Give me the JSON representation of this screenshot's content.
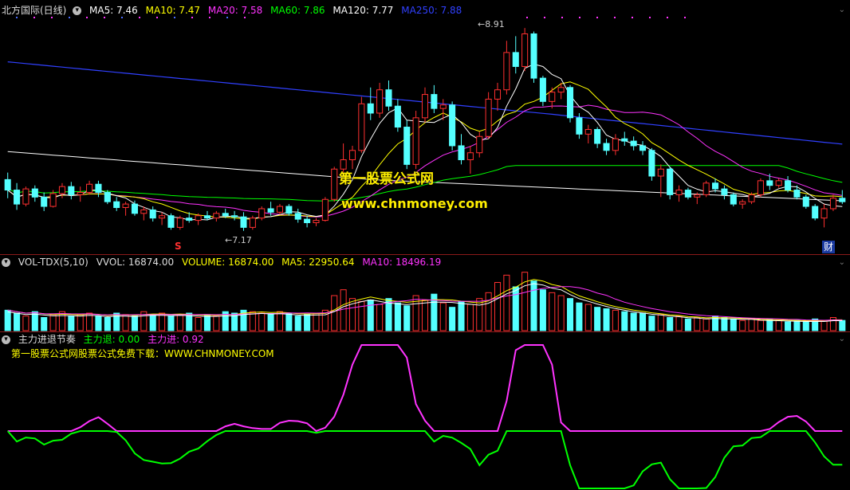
{
  "colors": {
    "up": "#ff3030",
    "down": "#54ffff",
    "ma5": "#ffffff",
    "ma10": "#ffff00",
    "ma20": "#ff33ff",
    "ma60": "#00ff00",
    "ma120": "#ffffff",
    "ma250": "#3040ff",
    "grid": "#8b1a1a"
  },
  "main": {
    "icon": "collapse-circle-icon",
    "title": "北方国际(日线)",
    "ma5": "MA5: 7.46",
    "ma10": "MA10: 7.47",
    "ma20": "MA20: 7.58",
    "ma60": "MA60: 7.86",
    "ma120": "MA120: 7.77",
    "ma250": "MA250: 7.88",
    "high_label": "8.91",
    "low_label": "7.17",
    "marker_s": "S",
    "marker_cai": "财",
    "watermark_title": "第一股票公式网",
    "watermark_url": "www.chnmoney.com"
  },
  "vol": {
    "title": "VOL-TDX(5,10)",
    "vvol": "VVOL: 16874.00",
    "volume": "VOLUME: 16874.00",
    "ma5": "MA5: 22950.64",
    "ma10": "MA10: 18496.19"
  },
  "ind": {
    "title": "主力进退节奏",
    "retreat": "主力退: 0.00",
    "advance": "主力进: 0.92",
    "note": "第一股票公式网股票公式免费下载：WWW.CHNMONEY.COM"
  },
  "chart_data": {
    "type": "candlestick",
    "price_range": [
      7.1,
      9.0
    ],
    "high": 8.91,
    "low": 7.17,
    "candles": [
      [
        7.61,
        7.67,
        7.45,
        7.52
      ],
      [
        7.52,
        7.58,
        7.35,
        7.4
      ],
      [
        7.4,
        7.55,
        7.38,
        7.53
      ],
      [
        7.53,
        7.56,
        7.42,
        7.46
      ],
      [
        7.46,
        7.5,
        7.34,
        7.38
      ],
      [
        7.38,
        7.52,
        7.37,
        7.49
      ],
      [
        7.49,
        7.58,
        7.45,
        7.55
      ],
      [
        7.55,
        7.59,
        7.44,
        7.48
      ],
      [
        7.48,
        7.55,
        7.42,
        7.5
      ],
      [
        7.5,
        7.6,
        7.48,
        7.57
      ],
      [
        7.57,
        7.6,
        7.46,
        7.5
      ],
      [
        7.5,
        7.52,
        7.4,
        7.42
      ],
      [
        7.42,
        7.46,
        7.34,
        7.37
      ],
      [
        7.37,
        7.42,
        7.3,
        7.4
      ],
      [
        7.4,
        7.43,
        7.3,
        7.32
      ],
      [
        7.32,
        7.38,
        7.26,
        7.35
      ],
      [
        7.35,
        7.38,
        7.25,
        7.28
      ],
      [
        7.28,
        7.33,
        7.22,
        7.3
      ],
      [
        7.3,
        7.32,
        7.18,
        7.2
      ],
      [
        7.2,
        7.3,
        7.18,
        7.28
      ],
      [
        7.28,
        7.33,
        7.24,
        7.26
      ],
      [
        7.26,
        7.32,
        7.22,
        7.3
      ],
      [
        7.3,
        7.34,
        7.26,
        7.28
      ],
      [
        7.28,
        7.34,
        7.25,
        7.32
      ],
      [
        7.32,
        7.36,
        7.28,
        7.3
      ],
      [
        7.3,
        7.34,
        7.26,
        7.29
      ],
      [
        7.29,
        7.33,
        7.17,
        7.2
      ],
      [
        7.2,
        7.3,
        7.18,
        7.28
      ],
      [
        7.28,
        7.38,
        7.26,
        7.36
      ],
      [
        7.36,
        7.42,
        7.3,
        7.33
      ],
      [
        7.33,
        7.4,
        7.31,
        7.38
      ],
      [
        7.38,
        7.4,
        7.3,
        7.32
      ],
      [
        7.32,
        7.36,
        7.24,
        7.27
      ],
      [
        7.27,
        7.3,
        7.2,
        7.24
      ],
      [
        7.24,
        7.28,
        7.21,
        7.26
      ],
      [
        7.26,
        7.46,
        7.25,
        7.44
      ],
      [
        7.44,
        7.72,
        7.42,
        7.7
      ],
      [
        7.7,
        7.92,
        7.66,
        7.78
      ],
      [
        7.78,
        7.9,
        7.7,
        7.86
      ],
      [
        7.86,
        8.32,
        7.84,
        8.26
      ],
      [
        8.26,
        8.4,
        8.12,
        8.18
      ],
      [
        8.18,
        8.44,
        8.14,
        8.38
      ],
      [
        8.38,
        8.46,
        8.2,
        8.24
      ],
      [
        8.24,
        8.3,
        8.02,
        8.06
      ],
      [
        8.06,
        8.12,
        7.7,
        7.74
      ],
      [
        7.74,
        8.2,
        7.7,
        8.14
      ],
      [
        8.14,
        8.4,
        8.1,
        8.34
      ],
      [
        8.34,
        8.42,
        8.18,
        8.22
      ],
      [
        8.22,
        8.3,
        8.12,
        8.25
      ],
      [
        8.25,
        8.28,
        7.86,
        7.9
      ],
      [
        7.9,
        8.0,
        7.74,
        7.78
      ],
      [
        7.78,
        7.9,
        7.66,
        7.84
      ],
      [
        7.84,
        8.02,
        7.8,
        7.98
      ],
      [
        7.98,
        8.36,
        7.96,
        8.3
      ],
      [
        8.3,
        8.44,
        8.2,
        8.38
      ],
      [
        8.38,
        8.8,
        8.34,
        8.7
      ],
      [
        8.7,
        8.84,
        8.52,
        8.58
      ],
      [
        8.58,
        8.91,
        8.54,
        8.86
      ],
      [
        8.86,
        8.88,
        8.44,
        8.48
      ],
      [
        8.48,
        8.5,
        8.24,
        8.28
      ],
      [
        8.28,
        8.4,
        8.22,
        8.36
      ],
      [
        8.36,
        8.44,
        8.3,
        8.4
      ],
      [
        8.4,
        8.42,
        8.1,
        8.14
      ],
      [
        8.14,
        8.18,
        7.96,
        8.0
      ],
      [
        8.0,
        8.08,
        7.92,
        8.04
      ],
      [
        8.04,
        8.06,
        7.88,
        7.92
      ],
      [
        7.92,
        7.96,
        7.82,
        7.86
      ],
      [
        7.86,
        8.0,
        7.82,
        7.96
      ],
      [
        7.96,
        8.02,
        7.9,
        7.94
      ],
      [
        7.94,
        7.98,
        7.86,
        7.9
      ],
      [
        7.9,
        7.94,
        7.82,
        7.86
      ],
      [
        7.86,
        7.88,
        7.6,
        7.64
      ],
      [
        7.64,
        7.74,
        7.46,
        7.7
      ],
      [
        7.7,
        7.72,
        7.44,
        7.48
      ],
      [
        7.48,
        7.56,
        7.42,
        7.52
      ],
      [
        7.52,
        7.54,
        7.44,
        7.46
      ],
      [
        7.46,
        7.5,
        7.4,
        7.48
      ],
      [
        7.48,
        7.6,
        7.46,
        7.58
      ],
      [
        7.58,
        7.62,
        7.5,
        7.53
      ],
      [
        7.53,
        7.56,
        7.44,
        7.48
      ],
      [
        7.48,
        7.5,
        7.38,
        7.4
      ],
      [
        7.4,
        7.44,
        7.36,
        7.42
      ],
      [
        7.42,
        7.5,
        7.4,
        7.48
      ],
      [
        7.48,
        7.62,
        7.46,
        7.6
      ],
      [
        7.6,
        7.66,
        7.52,
        7.56
      ],
      [
        7.56,
        7.62,
        7.54,
        7.6
      ],
      [
        7.6,
        7.64,
        7.5,
        7.52
      ],
      [
        7.52,
        7.56,
        7.44,
        7.46
      ],
      [
        7.46,
        7.48,
        7.36,
        7.38
      ],
      [
        7.38,
        7.4,
        7.26,
        7.28
      ],
      [
        7.28,
        7.4,
        7.2,
        7.36
      ],
      [
        7.36,
        7.48,
        7.34,
        7.45
      ],
      [
        7.45,
        7.52,
        7.4,
        7.42
      ]
    ],
    "volume": [
      14,
      12,
      10,
      13,
      9,
      11,
      13,
      10,
      11,
      12,
      10,
      9,
      12,
      11,
      10,
      13,
      11,
      12,
      10,
      11,
      12,
      9,
      11,
      10,
      13,
      12,
      14,
      13,
      12,
      11,
      13,
      12,
      10,
      11,
      12,
      14,
      24,
      28,
      22,
      20,
      21,
      18,
      22,
      19,
      17,
      24,
      21,
      25,
      19,
      16,
      20,
      18,
      22,
      26,
      33,
      38,
      30,
      40,
      34,
      28,
      26,
      24,
      22,
      19,
      18,
      16,
      15,
      14,
      13,
      12,
      12,
      10,
      11,
      9,
      10,
      8,
      9,
      8,
      10,
      9,
      8,
      7,
      8,
      7,
      8,
      7,
      6,
      7,
      6,
      8,
      7,
      9,
      7
    ],
    "ind_series": {
      "advance_range": [
        0,
        1
      ],
      "retreat_range": [
        -1,
        0
      ]
    }
  }
}
